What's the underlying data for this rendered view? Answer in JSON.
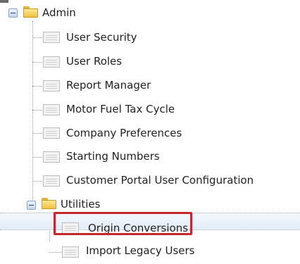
{
  "tree": {
    "admin": {
      "label": "Admin",
      "icon": "folder-open-icon",
      "expanded": true,
      "children": [
        {
          "label": "User Security",
          "icon": "page-icon"
        },
        {
          "label": "User Roles",
          "icon": "page-icon"
        },
        {
          "label": "Report Manager",
          "icon": "page-icon"
        },
        {
          "label": "Motor Fuel Tax Cycle",
          "icon": "page-icon"
        },
        {
          "label": "Company Preferences",
          "icon": "page-icon"
        },
        {
          "label": "Starting Numbers",
          "icon": "page-icon"
        },
        {
          "label": "Customer Portal User Configuration",
          "icon": "page-icon"
        }
      ]
    },
    "utilities": {
      "label": "Utilities",
      "icon": "folder-open-icon",
      "expanded": true,
      "children": [
        {
          "label": "Origin Conversions",
          "icon": "page-icon",
          "selected": true
        },
        {
          "label": "Import Legacy Users",
          "icon": "page-icon"
        }
      ]
    }
  },
  "colors": {
    "highlight_border": "#c4282e",
    "selection_background": "#e2ecf7",
    "folder": "#f0c241"
  }
}
